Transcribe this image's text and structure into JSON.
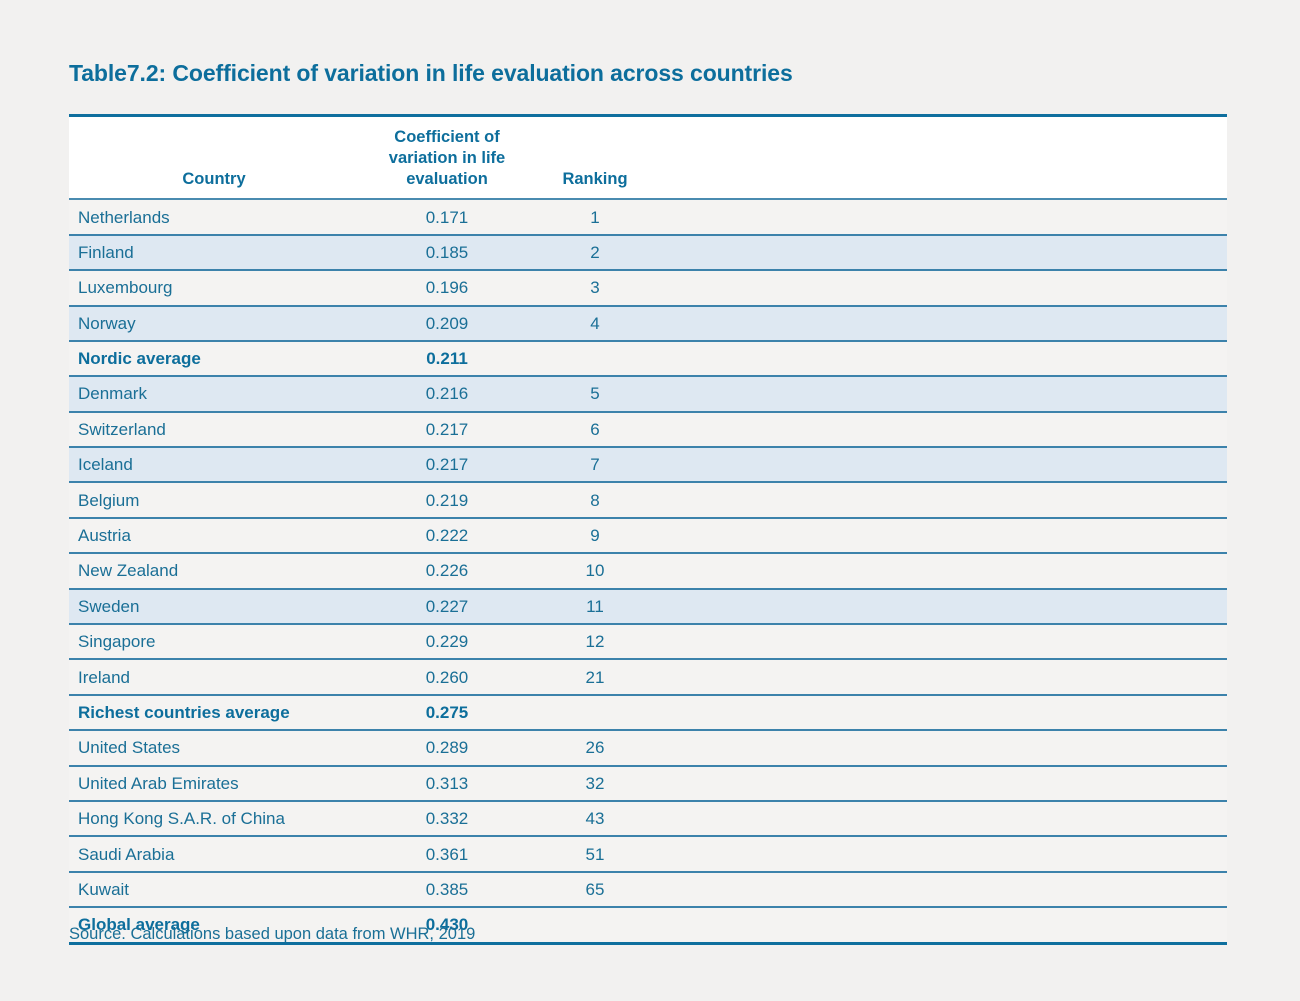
{
  "title": "Table7.2: Coefficient of variation in life evaluation across countries",
  "colors": {
    "page_background": "#f2f1f0",
    "heading_blue": "#0d6e9c",
    "body_blue": "#1a6f96",
    "rule_dark": "#0f6f9e",
    "rule_light": "#3c82ab",
    "row_light": "#f4f3f2",
    "row_blue": "#dee8f2",
    "header_background": "#ffffff"
  },
  "table": {
    "headers": {
      "country": "Country",
      "value": "Coefficient of variation in life evaluation",
      "ranking": "Ranking",
      "pad": ""
    },
    "rows": [
      {
        "country": "Netherlands",
        "value": "0.171",
        "ranking": "1",
        "stripe": "light",
        "summary": false
      },
      {
        "country": "Finland",
        "value": "0.185",
        "ranking": "2",
        "stripe": "blue",
        "summary": false
      },
      {
        "country": "Luxembourg",
        "value": "0.196",
        "ranking": "3",
        "stripe": "light",
        "summary": false
      },
      {
        "country": "Norway",
        "value": "0.209",
        "ranking": "4",
        "stripe": "blue",
        "summary": false
      },
      {
        "country": "Nordic average",
        "value": "0.211",
        "ranking": "",
        "stripe": "light",
        "summary": true
      },
      {
        "country": "Denmark",
        "value": "0.216",
        "ranking": "5",
        "stripe": "blue",
        "summary": false
      },
      {
        "country": "Switzerland",
        "value": "0.217",
        "ranking": "6",
        "stripe": "light",
        "summary": false
      },
      {
        "country": "Iceland",
        "value": "0.217",
        "ranking": "7",
        "stripe": "blue",
        "summary": false
      },
      {
        "country": "Belgium",
        "value": "0.219",
        "ranking": "8",
        "stripe": "light",
        "summary": false
      },
      {
        "country": "Austria",
        "value": "0.222",
        "ranking": "9",
        "stripe": "light",
        "summary": false
      },
      {
        "country": "New Zealand",
        "value": "0.226",
        "ranking": "10",
        "stripe": "light",
        "summary": false
      },
      {
        "country": "Sweden",
        "value": "0.227",
        "ranking": "11",
        "stripe": "blue",
        "summary": false
      },
      {
        "country": "Singapore",
        "value": "0.229",
        "ranking": "12",
        "stripe": "light",
        "summary": false
      },
      {
        "country": "Ireland",
        "value": "0.260",
        "ranking": "21",
        "stripe": "light",
        "summary": false
      },
      {
        "country": "Richest countries average",
        "value": "0.275",
        "ranking": "",
        "stripe": "light",
        "summary": true
      },
      {
        "country": "United States",
        "value": "0.289",
        "ranking": "26",
        "stripe": "light",
        "summary": false
      },
      {
        "country": "United Arab Emirates",
        "value": "0.313",
        "ranking": "32",
        "stripe": "light",
        "summary": false
      },
      {
        "country": "Hong Kong S.A.R. of China",
        "value": "0.332",
        "ranking": "43",
        "stripe": "light",
        "summary": false
      },
      {
        "country": "Saudi Arabia",
        "value": "0.361",
        "ranking": "51",
        "stripe": "light",
        "summary": false
      },
      {
        "country": "Kuwait",
        "value": "0.385",
        "ranking": "65",
        "stripe": "light",
        "summary": false
      },
      {
        "country": "Global average",
        "value": "0.430",
        "ranking": "",
        "stripe": "light",
        "summary": true
      }
    ]
  },
  "source": "Source. Calculations based upon data from WHR, 2019"
}
